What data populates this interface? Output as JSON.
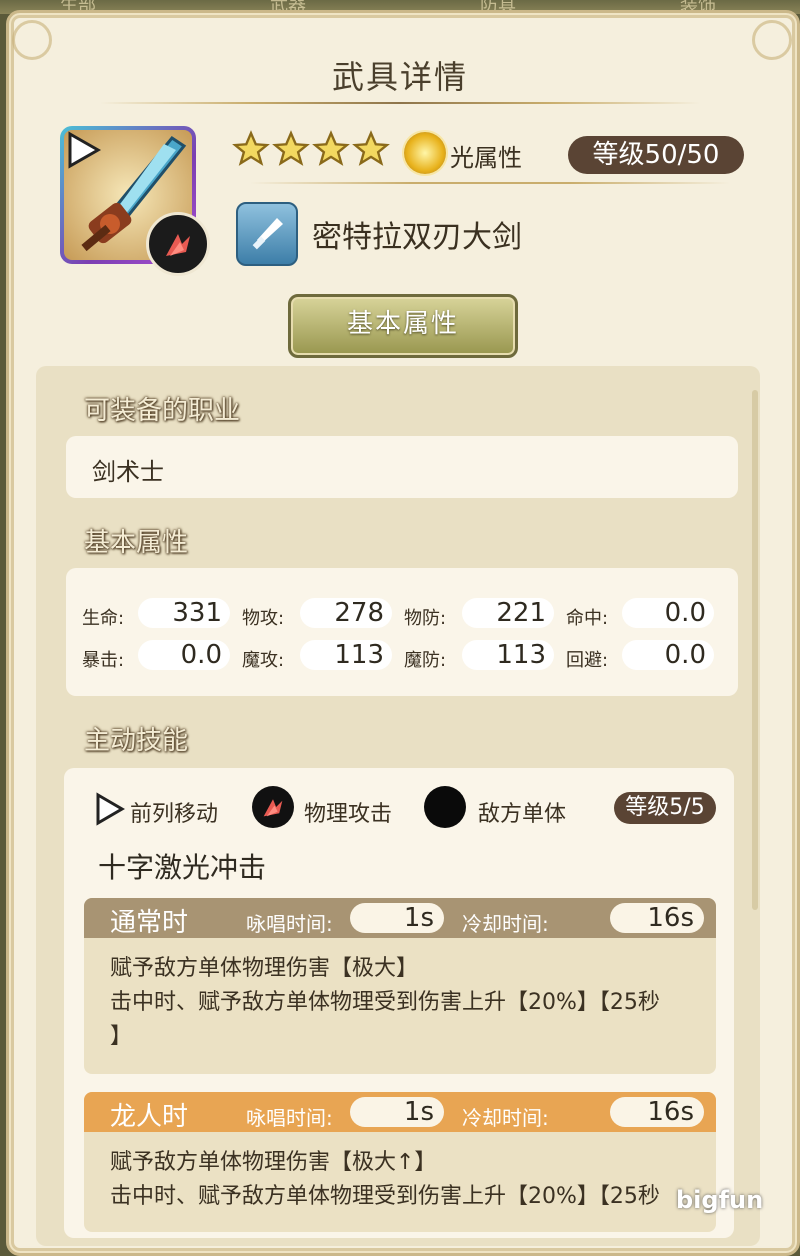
{
  "top_tabs": [
    "生部",
    "武器",
    "防具",
    "装饰"
  ],
  "header": {
    "title": "武具详情"
  },
  "weapon": {
    "stars": 4,
    "attribute_label": "光属性",
    "level": "等级50/50",
    "name": "密特拉双刃大剑"
  },
  "tabs": {
    "basic_attributes_button": "基本属性"
  },
  "equip_section": {
    "title": "可装备的职业",
    "job": "剑术士"
  },
  "stats_section": {
    "title": "基本属性",
    "stats": [
      {
        "label": "生命:",
        "value": "331"
      },
      {
        "label": "物攻:",
        "value": "278"
      },
      {
        "label": "物防:",
        "value": "221"
      },
      {
        "label": "命中:",
        "value": "0.0"
      },
      {
        "label": "暴击:",
        "value": "0.0"
      },
      {
        "label": "魔攻:",
        "value": "113"
      },
      {
        "label": "魔防:",
        "value": "113"
      },
      {
        "label": "回避:",
        "value": "0.0"
      }
    ]
  },
  "skill_section": {
    "title": "主动技能",
    "tags": [
      "前列移动",
      "物理攻击",
      "敌方单体"
    ],
    "level": "等级5/5",
    "name": "十字激光冲击",
    "modes": [
      {
        "name": "通常时",
        "cast_label": "咏唱时间:",
        "cast_value": "1s",
        "cooldown_label": "冷却时间:",
        "cooldown_value": "16s",
        "desc_lines": [
          "赋予敌方单体物理伤害【极大】",
          "击中时、赋予敌方单体物理受到伤害上升【20%】【25秒",
          "】"
        ],
        "header_color": "#a89473"
      },
      {
        "name": "龙人时",
        "cast_label": "咏唱时间:",
        "cast_value": "1s",
        "cooldown_label": "冷却时间:",
        "cooldown_value": "16s",
        "desc_lines": [
          "赋予敌方单体物理伤害【极大↑】",
          "击中时、赋予敌方单体物理受到伤害上升【20%】【25秒"
        ],
        "header_color": "#e8a553"
      }
    ]
  },
  "watermark": "bigfun",
  "colors": {
    "panel_bg": "#f5efdd",
    "dark_pill": "#5a4434",
    "accent_gold": "#c9ad6c"
  }
}
